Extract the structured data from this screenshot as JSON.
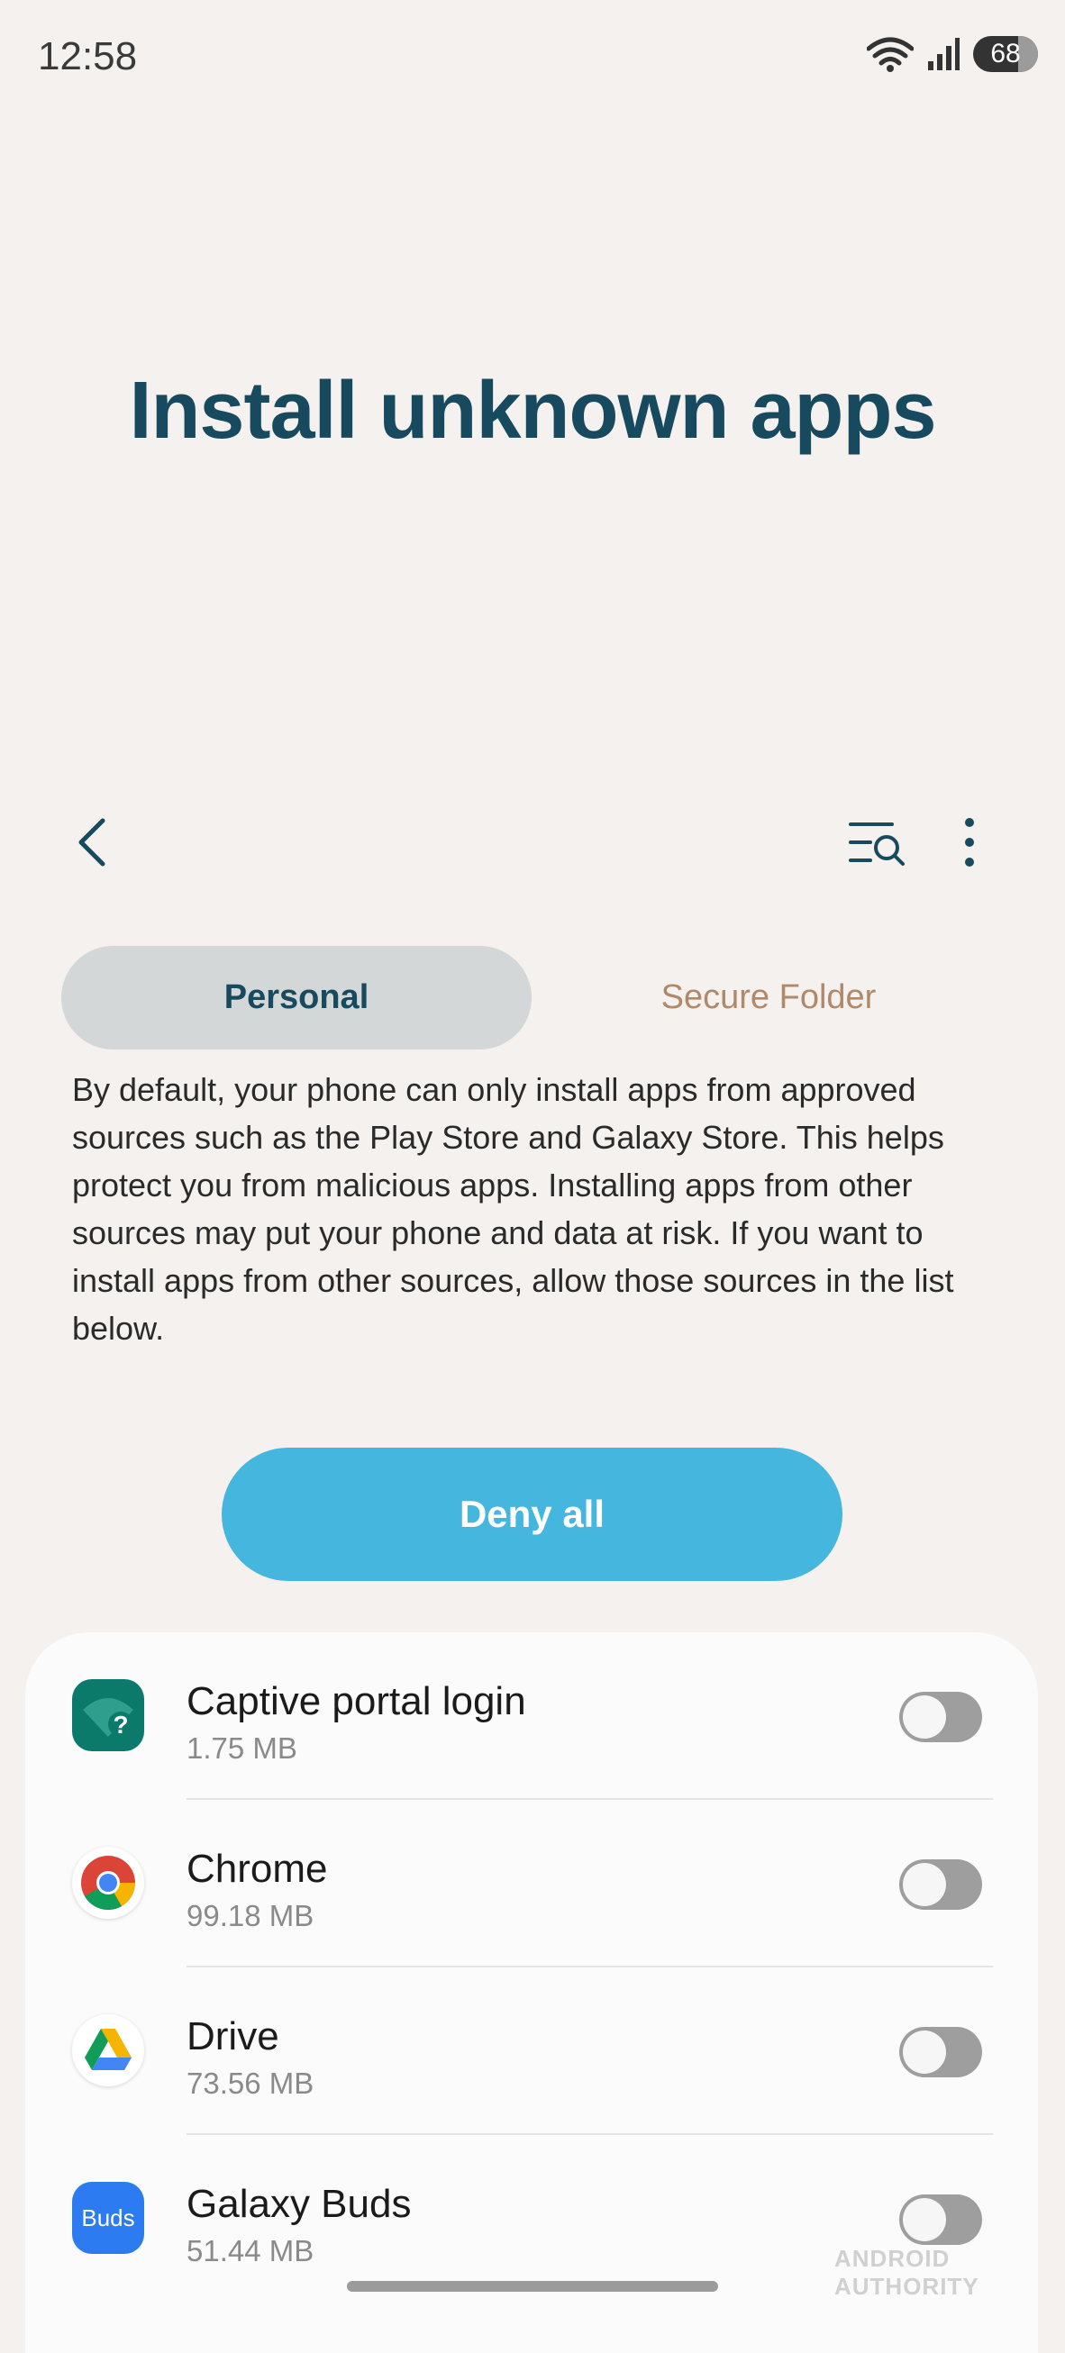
{
  "status_bar": {
    "time": "12:58",
    "battery": "68"
  },
  "page": {
    "title": "Install unknown apps"
  },
  "tabs": [
    {
      "label": "Personal",
      "selected": true
    },
    {
      "label": "Secure Folder",
      "selected": false
    }
  ],
  "description": "By default, your phone can only install apps from approved sources such as the Play Store and Galaxy Store. This helps protect you from malicious apps. Installing apps from other sources may put your phone and data at risk. If you want to install apps from other sources, allow those sources in the list below.",
  "deny_all_label": "Deny all",
  "apps": [
    {
      "name": "Captive portal login",
      "size": "1.75 MB",
      "allowed": false,
      "icon": "captive-portal-icon"
    },
    {
      "name": "Chrome",
      "size": "99.18 MB",
      "allowed": false,
      "icon": "chrome-icon"
    },
    {
      "name": "Drive",
      "size": "73.56 MB",
      "allowed": false,
      "icon": "drive-icon"
    },
    {
      "name": "Galaxy Buds",
      "size": "51.44 MB",
      "allowed": false,
      "icon": "galaxy-buds-icon",
      "icon_text": "Buds"
    }
  ],
  "watermark": "ANDROID AUTHORITY",
  "colors": {
    "accent": "#45b6de",
    "title": "#174a5e",
    "background": "#f4f1ee"
  }
}
